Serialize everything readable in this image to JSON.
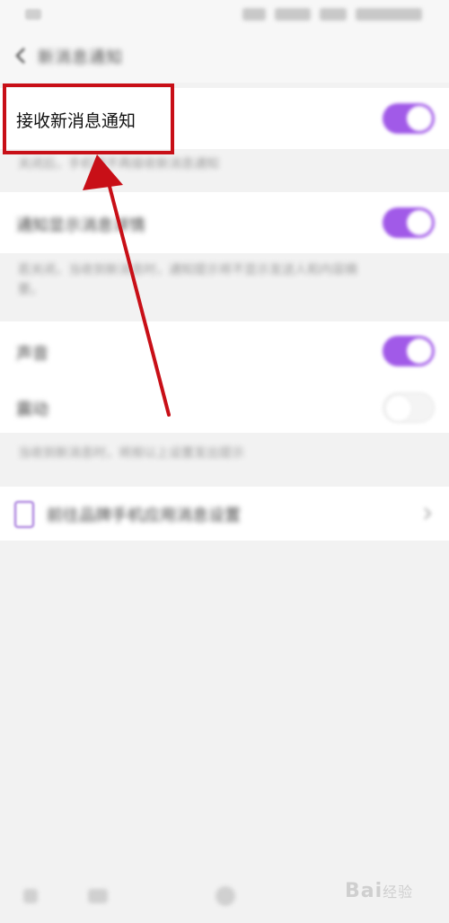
{
  "header": {
    "title": "新消息通知",
    "back_icon": "chevron-left-icon"
  },
  "settings": {
    "receive_new_messages": {
      "label": "接收新消息通知",
      "enabled": true,
      "description": "关闭后，手机将不再接收新消息通知"
    },
    "show_message_details": {
      "label": "通知显示消息详情",
      "enabled": true,
      "description": "若关闭，当收到新消息时，通知提示将不显示发送人和内容摘要。"
    },
    "sound": {
      "label": "声音",
      "enabled": true
    },
    "vibrate": {
      "label": "震动",
      "enabled": false
    },
    "sound_vibrate_description": "当收到新消息时，将按以上设置发出提示",
    "brand_settings": {
      "label": "前往品牌手机应用消息设置",
      "icon": "phone-app-icon",
      "chevron": "chevron-right-icon"
    }
  },
  "colors": {
    "toggle_on": "#a15ae8",
    "annotation": "#c80f17",
    "background": "#f2f2f2"
  },
  "watermark": {
    "brand": "Bai",
    "suffix": "经验"
  }
}
